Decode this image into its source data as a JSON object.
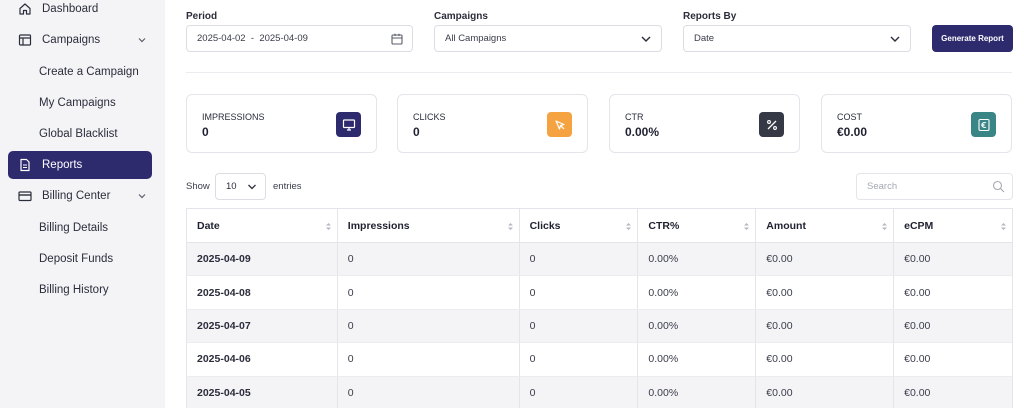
{
  "sidebar": {
    "items": [
      {
        "label": "Dashboard",
        "icon": "home-icon"
      },
      {
        "label": "Campaigns",
        "icon": "layout-icon"
      },
      {
        "label": "Create a Campaign"
      },
      {
        "label": "My Campaigns"
      },
      {
        "label": "Global Blacklist"
      },
      {
        "label": "Reports",
        "icon": "document-icon",
        "active": true
      },
      {
        "label": "Billing Center",
        "icon": "credit-card-icon"
      },
      {
        "label": "Billing Details"
      },
      {
        "label": "Deposit Funds"
      },
      {
        "label": "Billing History"
      }
    ]
  },
  "filters": {
    "period_label": "Period",
    "period_value": "2025-04-02  -  2025-04-09",
    "campaigns_label": "Campaigns",
    "campaigns_value": "All Campaigns",
    "reports_by_label": "Reports By",
    "reports_by_value": "Date",
    "generate_label": "Generate Report"
  },
  "cards": [
    {
      "label": "IMPRESSIONS",
      "value": "0",
      "icon": "monitor-icon",
      "color": "#2d2a6e"
    },
    {
      "label": "CLICKS",
      "value": "0",
      "icon": "cursor-icon",
      "color": "#f5a340"
    },
    {
      "label": "CTR",
      "value": "0.00%",
      "icon": "percent-icon",
      "color": "#353845"
    },
    {
      "label": "COST",
      "value": "€0.00",
      "icon": "euro-icon",
      "color": "#3a8585"
    }
  ],
  "table_controls": {
    "show_label": "Show",
    "entries_value": "10",
    "entries_label": "entries",
    "search_placeholder": "Search"
  },
  "table": {
    "headers": [
      "Date",
      "Impressions",
      "Clicks",
      "CTR%",
      "Amount",
      "eCPM"
    ],
    "rows": [
      [
        "2025-04-09",
        "0",
        "0",
        "0.00%",
        "€0.00",
        "€0.00"
      ],
      [
        "2025-04-08",
        "0",
        "0",
        "0.00%",
        "€0.00",
        "€0.00"
      ],
      [
        "2025-04-07",
        "0",
        "0",
        "0.00%",
        "€0.00",
        "€0.00"
      ],
      [
        "2025-04-06",
        "0",
        "0",
        "0.00%",
        "€0.00",
        "€0.00"
      ],
      [
        "2025-04-05",
        "0",
        "0",
        "0.00%",
        "€0.00",
        "€0.00"
      ]
    ]
  }
}
